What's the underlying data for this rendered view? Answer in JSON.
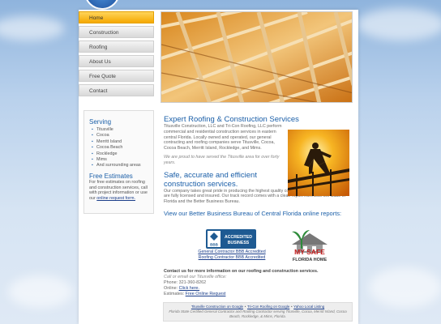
{
  "nav": {
    "items": [
      {
        "label": "Home"
      },
      {
        "label": "Construction"
      },
      {
        "label": "Roofing"
      },
      {
        "label": "About Us"
      },
      {
        "label": "Free Quote"
      },
      {
        "label": "Contact"
      }
    ],
    "active_color": "#f5a800"
  },
  "sidebar": {
    "serving_title": "Serving",
    "areas": [
      "Titusville",
      "Cocoa",
      "Merritt Island",
      "Cocoa Beach",
      "Rockledge",
      "Mims",
      "And surrounding areas"
    ],
    "estimates_title": "Free Estimates",
    "estimates_text": "For free estimates on roofing and construction services, call with project information or use our",
    "estimates_link": "online request form.",
    "estimates_end": ""
  },
  "main": {
    "title": "Expert Roofing & Construction Services",
    "intro": "Titusville Construction, LLC and Tri-Con Roofing, LLC perform commercial and residential construction services in eastern central Florida. Locally owned and operated, our general contracting and roofing companies serve Titusville, Cocoa, Cocoa Beach, Merritt Island, Rockledge, and Mims.",
    "proud": "We are proud to have served the Titusville area for over forty years.",
    "subtitle": "Safe, accurate and efficient construction services.",
    "safe_text": "Our company takes great pride in producing the highest quality construction projects possible. We are fully licensed and insured. Our track record comes with a clean report from both the State of Florida and the Better Business Bureau.",
    "bbb_title": "View our Better Business Bureau of Central Florida online reports:",
    "bbb_logo_line1": "ACCREDITED",
    "bbb_logo_line2": "BUSINESS",
    "bbb_logo_mark": "BBB",
    "bbb_links": [
      "General Contractor BBB Accredited",
      "Roofing Contractor BBB Accredited"
    ],
    "mysafe_line1": "MY SAFE",
    "mysafe_line2": "FLORIDA HOME"
  },
  "contact": {
    "heading": "Contact us for more information on our roofing and construction services.",
    "call": "Call or email our Titusville office:",
    "phone_label": "Phone:",
    "phone": "321-360-8262",
    "online_label": "Online:",
    "online_link": "Click here.",
    "estimates_label": "Estimates:",
    "estimates_link": "Free Online Request"
  },
  "footer": {
    "links": [
      "Titusville Construction on Google",
      "Tri-Con Roofing on Google",
      "Yahoo Local Listing"
    ],
    "text": "Florida State Certified General Contractor and Roofing Contractor serving Titusville, Cocoa, Merritt Island, Cocoa Beach, Rockledge, & Mims, Florida."
  }
}
